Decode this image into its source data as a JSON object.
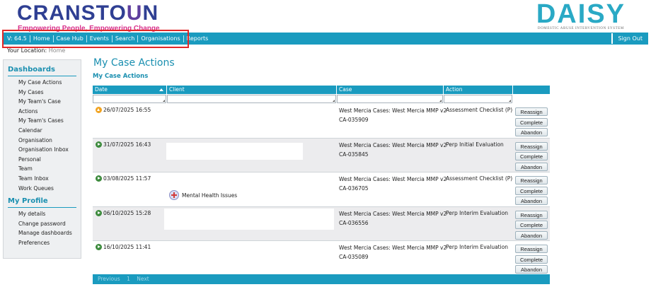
{
  "header": {
    "org_name_a": "CRANSTO",
    "org_name_u": "U",
    "org_name_b": "N",
    "tagline": "Empowering People, Empowering Change",
    "system_name": "DAISY",
    "system_subtitle": "DOMESTIC ABUSE INTERVENTION SYSTEM"
  },
  "nav": {
    "version": "V: 64.5",
    "items": [
      "Home",
      "Case Hub",
      "Events",
      "Search",
      "Organisations",
      "Reports"
    ],
    "sign_out": "Sign Out"
  },
  "location": {
    "label": "Your Location:",
    "value": "Home"
  },
  "sidebar": {
    "dashboards_title": "Dashboards",
    "dashboards": [
      "My Case Actions",
      "My Cases",
      "My Team's Case",
      "Actions",
      "My Team's Cases",
      "Calendar",
      "Organisation",
      "Organisation Inbox",
      "Personal",
      "Team",
      "Team Inbox",
      "Work Queues"
    ],
    "profile_title": "My Profile",
    "profile": [
      "My details",
      "Change password",
      "Manage dashboards",
      "Preferences"
    ]
  },
  "main": {
    "title": "My Case Actions",
    "subtitle": "My Case Actions",
    "columns": [
      "Date",
      "Client",
      "Case",
      "Action"
    ],
    "rows": [
      {
        "status": "warning",
        "date": "26/07/2025 16:55",
        "client": "",
        "case": "West Mercia Cases: West Mercia MMP v2",
        "case_id": "CA-035909",
        "action": "Assessment Checklist (P)"
      },
      {
        "status": "in-progress",
        "date": "31/07/2025 16:43",
        "client": "",
        "case": "West Mercia Cases: West Mercia MMP v2",
        "case_id": "CA-035845",
        "action": "Perp Initial Evaluation"
      },
      {
        "status": "in-progress",
        "date": "03/08/2025 11:57",
        "client": "Mental Health Issues",
        "case": "West Mercia Cases: West Mercia MMP v2",
        "case_id": "CA-036705",
        "action": "Assessment Checklist (P)"
      },
      {
        "status": "in-progress",
        "date": "06/10/2025 15:28",
        "client": "",
        "case": "West Mercia Cases: West Mercia MMP v2",
        "case_id": "CA-036556",
        "action": "Perp Interim Evaluation"
      },
      {
        "status": "in-progress",
        "date": "16/10/2025 11:41",
        "client": "",
        "case": "West Mercia Cases: West Mercia MMP v2",
        "case_id": "CA-035089",
        "action": "Perp Interim Evaluation"
      }
    ],
    "buttons": {
      "reassign": "Reassign",
      "complete": "Complete",
      "abandon": "Abandon"
    },
    "pager": {
      "previous": "Previous",
      "page": "1",
      "next": "Next"
    }
  },
  "colors": {
    "accent": "#1a9bbf",
    "brand": "#2f3f93",
    "tagline": "#d8308a",
    "highlight": "#e32727"
  }
}
